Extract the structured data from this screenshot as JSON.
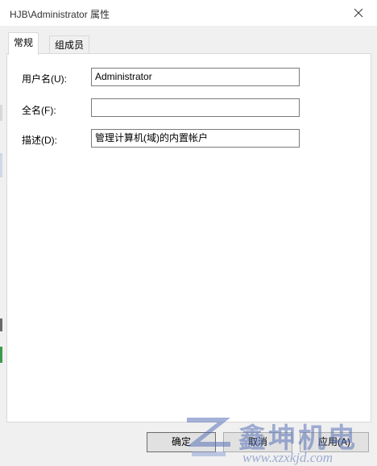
{
  "window": {
    "title": "HJB\\Administrator 属性"
  },
  "tabs": [
    {
      "label": "常规",
      "active": true
    },
    {
      "label": "组成员",
      "active": false
    }
  ],
  "form": {
    "username_label": "用户名(U):",
    "username_value": "Administrator",
    "fullname_label": "全名(F):",
    "fullname_value": "",
    "description_label": "描述(D):",
    "description_value": "管理计算机(域)的内置帐户"
  },
  "buttons": {
    "ok": "确定",
    "cancel": "取消",
    "apply": "应用(A)"
  },
  "watermark": {
    "brand": "鑫坤机电",
    "url": "www.xzxkjd.com"
  },
  "colors": {
    "panel": "#ffffff",
    "window": "#f0f0f0",
    "field_border": "#7a7a7a",
    "watermark": "#5a73b8"
  }
}
